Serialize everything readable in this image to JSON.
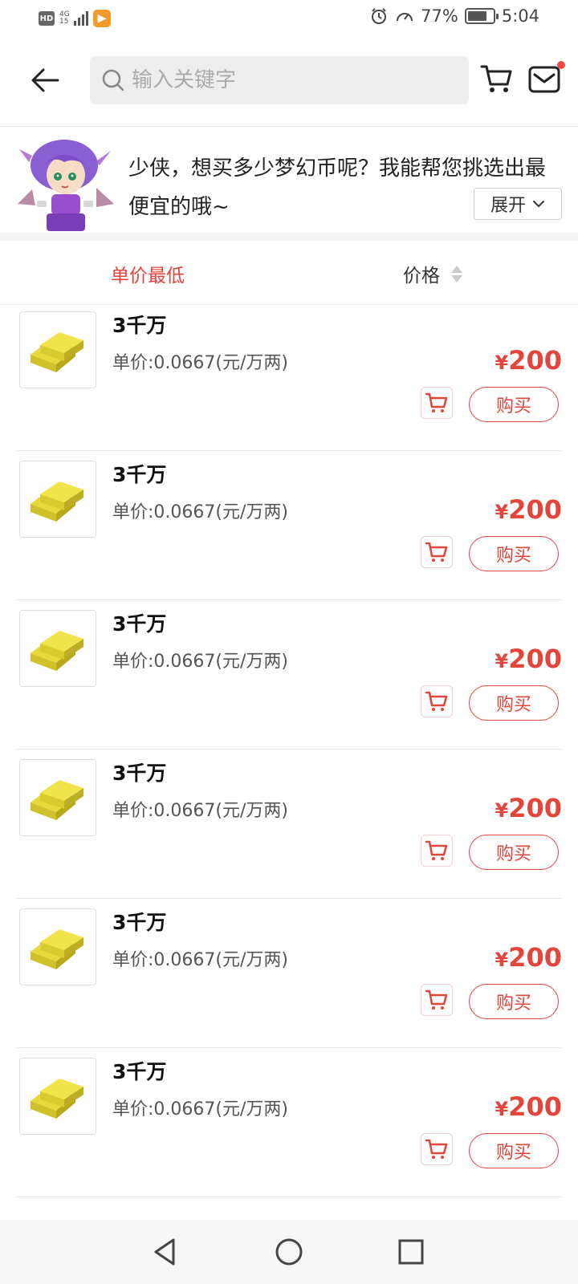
{
  "status_bar": {
    "hd": "HD",
    "network": "4G",
    "network_sub": "15",
    "battery": "77%",
    "battery_level": 0.77,
    "time": "5:04"
  },
  "header": {
    "search_placeholder": "输入关键字",
    "has_mail_notification": true,
    "accent_color": "#e2453c"
  },
  "banner": {
    "message": "少侠，想买多少梦幻币呢？我能帮您挑选出最便宜的哦~",
    "expand_label": "展开"
  },
  "sort_bar": {
    "lowest_unit_label": "单价最低",
    "price_label": "价格"
  },
  "items": [
    {
      "title": "3千万",
      "unit_price": "单价:0.0667(元/万两)",
      "currency": "¥",
      "price": "200",
      "buy_label": "购买"
    },
    {
      "title": "3千万",
      "unit_price": "单价:0.0667(元/万两)",
      "currency": "¥",
      "price": "200",
      "buy_label": "购买"
    },
    {
      "title": "3千万",
      "unit_price": "单价:0.0667(元/万两)",
      "currency": "¥",
      "price": "200",
      "buy_label": "购买"
    },
    {
      "title": "3千万",
      "unit_price": "单价:0.0667(元/万两)",
      "currency": "¥",
      "price": "200",
      "buy_label": "购买"
    },
    {
      "title": "3千万",
      "unit_price": "单价:0.0667(元/万两)",
      "currency": "¥",
      "price": "200",
      "buy_label": "购买"
    },
    {
      "title": "3千万",
      "unit_price": "单价:0.0667(元/万两)",
      "currency": "¥",
      "price": "200",
      "buy_label": "购买"
    }
  ]
}
